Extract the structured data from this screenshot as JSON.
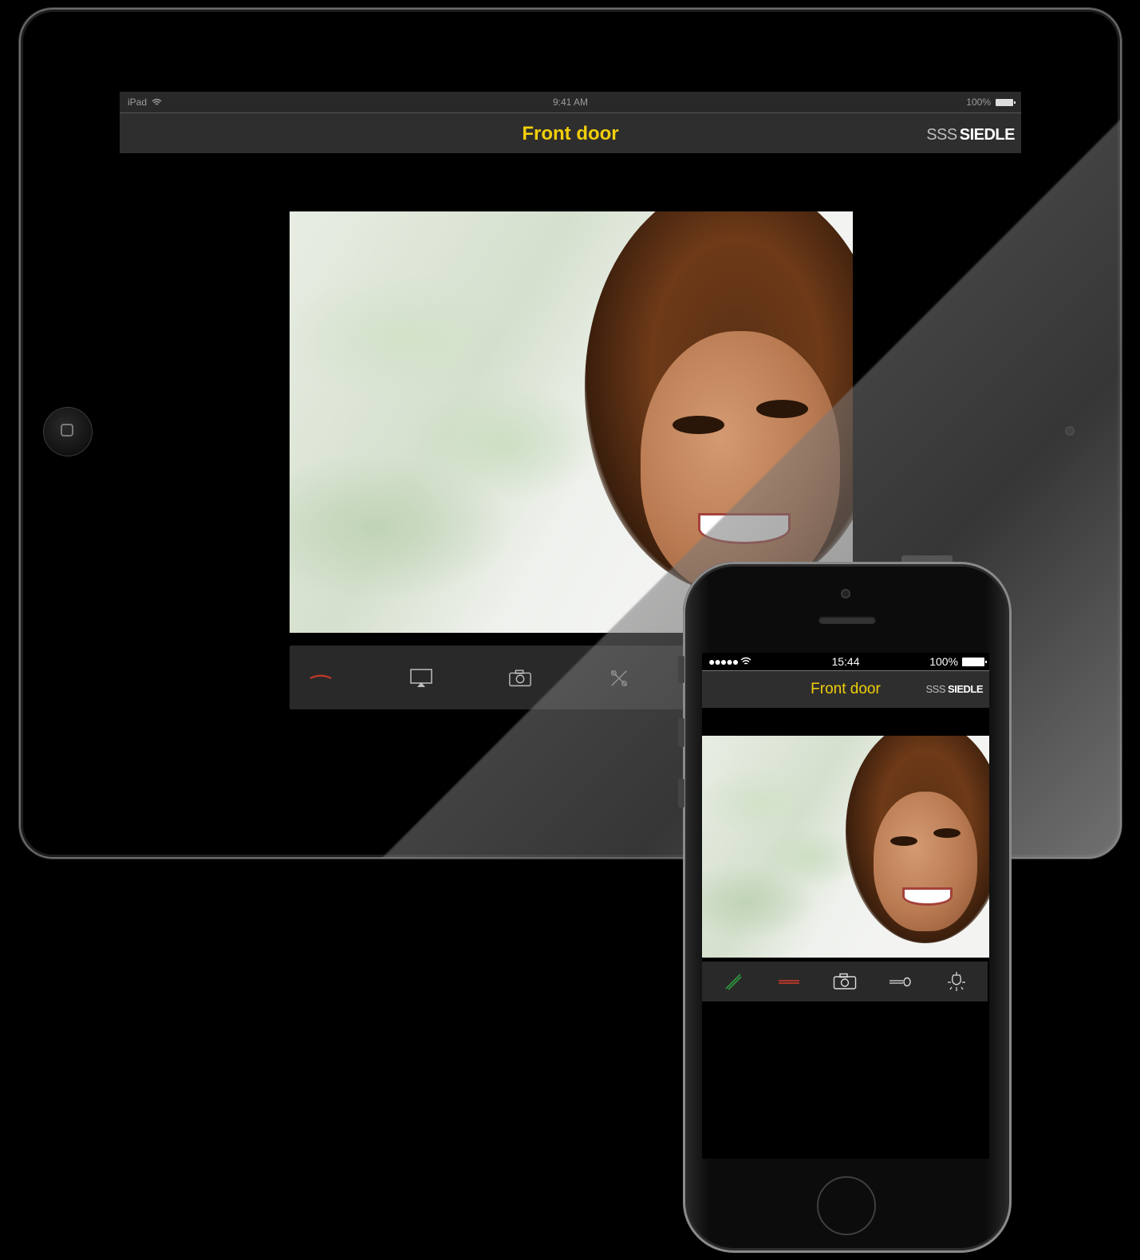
{
  "ipad": {
    "status": {
      "device": "iPad",
      "time": "9:41 AM",
      "battery": "100%"
    },
    "nav": {
      "title": "Front door",
      "brand_prefix": "SSS",
      "brand": "SIEDLE"
    },
    "controls": [
      "hang-up",
      "airplay",
      "camera",
      "mute"
    ]
  },
  "iphone": {
    "status": {
      "signal": "●●●●●",
      "time": "15:44",
      "battery": "100%"
    },
    "nav": {
      "title": "Front door",
      "brand_prefix": "SSS",
      "brand": "SIEDLE"
    },
    "controls": [
      "accept-call",
      "hang-up",
      "camera",
      "door-key",
      "light"
    ]
  },
  "colors": {
    "title_yellow": "#f0cf0a",
    "hangup_red": "#c0392b",
    "accept_green": "#2e9b3e",
    "bar_gray": "#2a2929"
  }
}
